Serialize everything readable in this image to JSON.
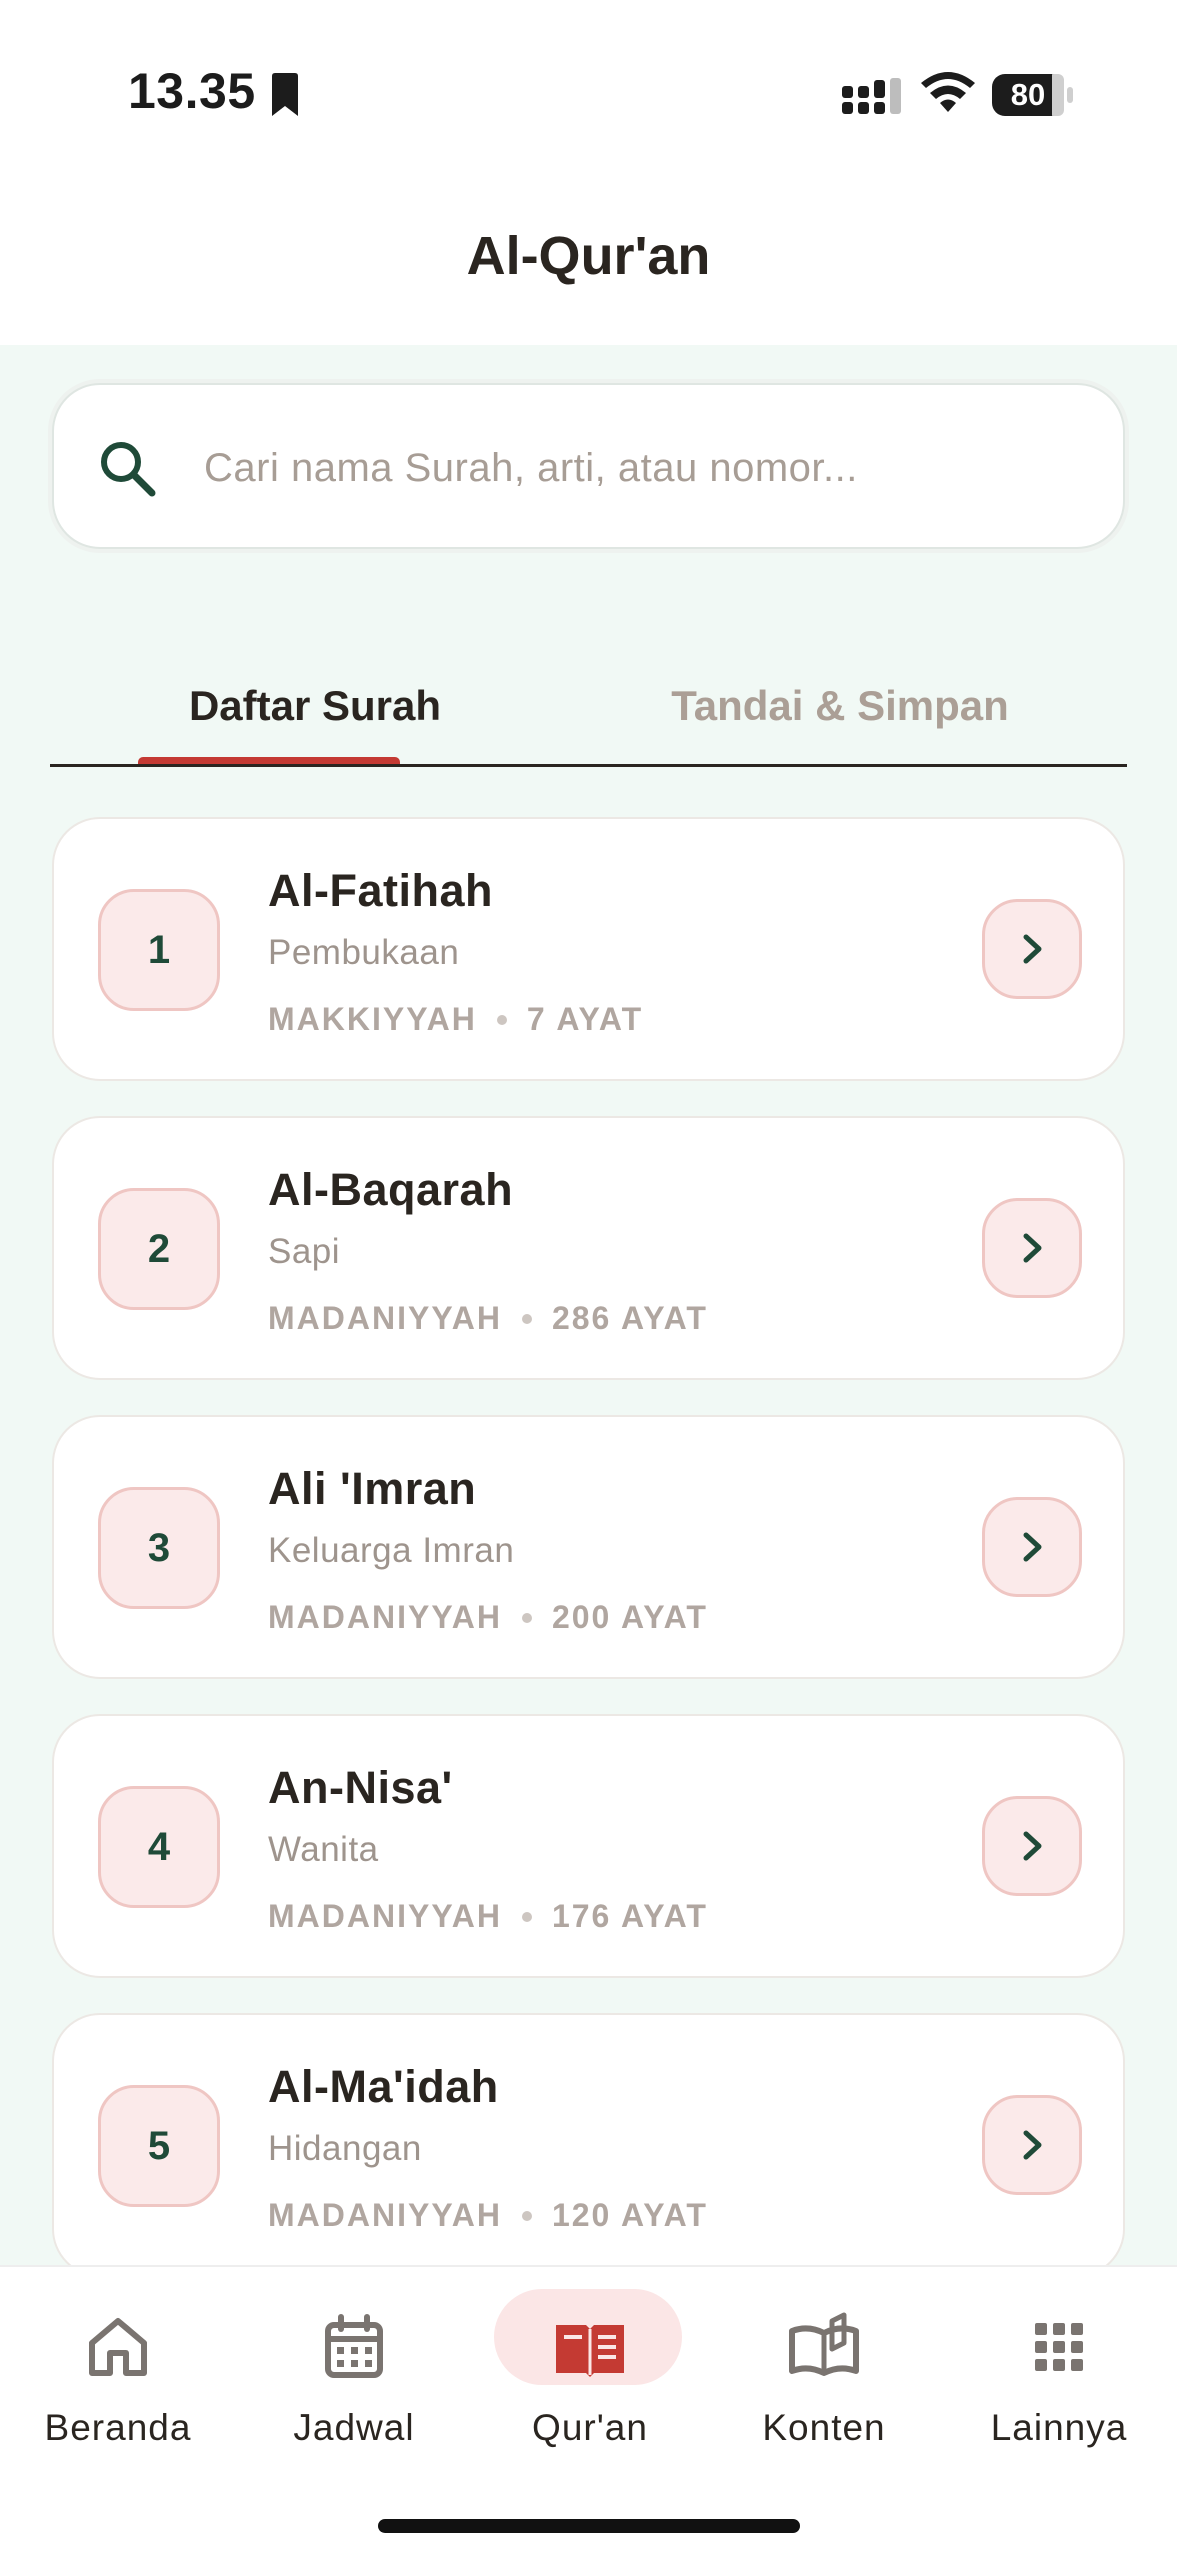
{
  "status_bar": {
    "time": "13.35",
    "battery": "80"
  },
  "header": {
    "title": "Al-Qur'an"
  },
  "search": {
    "placeholder": "Cari nama Surah, arti, atau nomor...",
    "value": ""
  },
  "tabs": [
    {
      "label": "Daftar Surah",
      "active": true
    },
    {
      "label": "Tandai & Simpan",
      "active": false
    }
  ],
  "surahs": [
    {
      "number": "1",
      "name": "Al-Fatihah",
      "meaning": "Pembukaan",
      "type": "MAKKIYYAH",
      "verses": "7 AYAT"
    },
    {
      "number": "2",
      "name": "Al-Baqarah",
      "meaning": "Sapi",
      "type": "MADANIYYAH",
      "verses": "286 AYAT"
    },
    {
      "number": "3",
      "name": "Ali 'Imran",
      "meaning": "Keluarga Imran",
      "type": "MADANIYYAH",
      "verses": "200 AYAT"
    },
    {
      "number": "4",
      "name": "An-Nisa'",
      "meaning": "Wanita",
      "type": "MADANIYYAH",
      "verses": "176 AYAT"
    },
    {
      "number": "5",
      "name": "Al-Ma'idah",
      "meaning": "Hidangan",
      "type": "MADANIYYAH",
      "verses": "120 AYAT"
    }
  ],
  "bottom_nav": [
    {
      "label": "Beranda",
      "icon": "home-icon",
      "active": false
    },
    {
      "label": "Jadwal",
      "icon": "calendar-icon",
      "active": false
    },
    {
      "label": "Qur'an",
      "icon": "quran-book-icon",
      "active": true
    },
    {
      "label": "Konten",
      "icon": "open-book-icon",
      "active": false
    },
    {
      "label": "Lainnya",
      "icon": "grid-icon",
      "active": false
    }
  ],
  "colors": {
    "accent_red": "#c43a33",
    "primary_green": "#1f4a38",
    "badge_bg": "#fbeaea",
    "content_bg": "#f1f9f5"
  }
}
